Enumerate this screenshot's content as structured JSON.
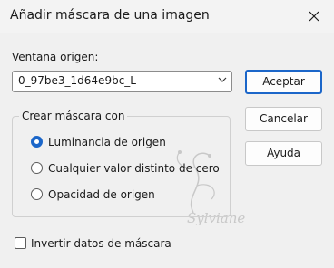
{
  "window": {
    "title": "Añadir máscara de una imagen"
  },
  "source": {
    "label": "Ventana origen:",
    "selected_value": "0_97be3_1d64e9bc_L"
  },
  "buttons": {
    "ok": "Aceptar",
    "cancel": "Cancelar",
    "help": "Ayuda"
  },
  "mask_group": {
    "legend": "Crear máscara con",
    "options": [
      {
        "label": "Luminancia de origen",
        "selected": true
      },
      {
        "label": "Cualquier valor distinto de cero",
        "selected": false
      },
      {
        "label": "Opacidad de origen",
        "selected": false
      }
    ]
  },
  "invert": {
    "label": "Invertir datos de máscara",
    "checked": false
  },
  "watermark": {
    "text": "Sylviane"
  },
  "colors": {
    "accent": "#1b66c9",
    "background": "#f0f0f0"
  }
}
